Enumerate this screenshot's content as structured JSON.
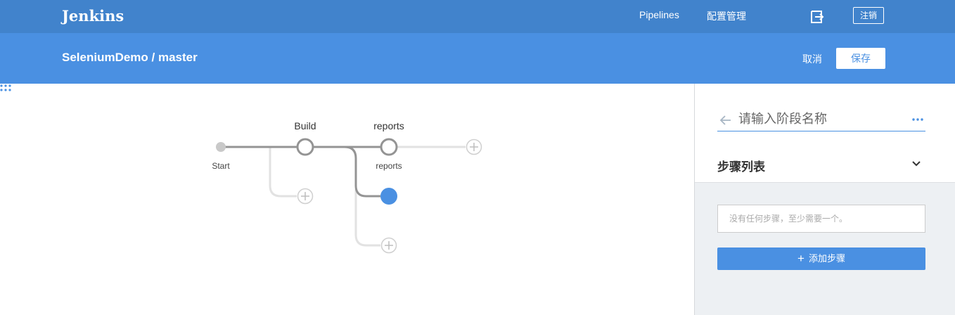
{
  "header": {
    "brand": "Jenkins",
    "nav": [
      {
        "label": "Pipelines"
      },
      {
        "label": "配置管理"
      }
    ],
    "exit_icon": "sign-out-icon",
    "logout_label": "注销"
  },
  "subheader": {
    "title": "SeleniumDemo / master",
    "cancel_label": "取消",
    "save_label": "保存"
  },
  "pipeline": {
    "start_label": "Start",
    "stages": [
      {
        "name": "Build",
        "nodes": [
          {
            "label": "",
            "selected": false
          }
        ]
      },
      {
        "name": "reports",
        "nodes": [
          {
            "label": "reports",
            "selected": false
          },
          {
            "label": "",
            "selected": true
          }
        ]
      }
    ],
    "add_icon": "plus-circle-icon",
    "drag_icon": "grip-dots-icon"
  },
  "panel": {
    "stage_name_placeholder": "请输入阶段名称",
    "back_icon": "arrow-left-icon",
    "more_icon": "ellipsis-icon",
    "steps_title": "步骤列表",
    "collapse_icon": "chevron-down-icon",
    "empty_text": "没有任何步骤，至少需要一个。",
    "add_step_icon": "plus-icon",
    "add_step_label": "添加步骤"
  },
  "colors": {
    "topbar": "#4183cc",
    "subbar": "#4a90e2",
    "accent": "#4a90e2",
    "panel_bg": "#edf0f3"
  }
}
